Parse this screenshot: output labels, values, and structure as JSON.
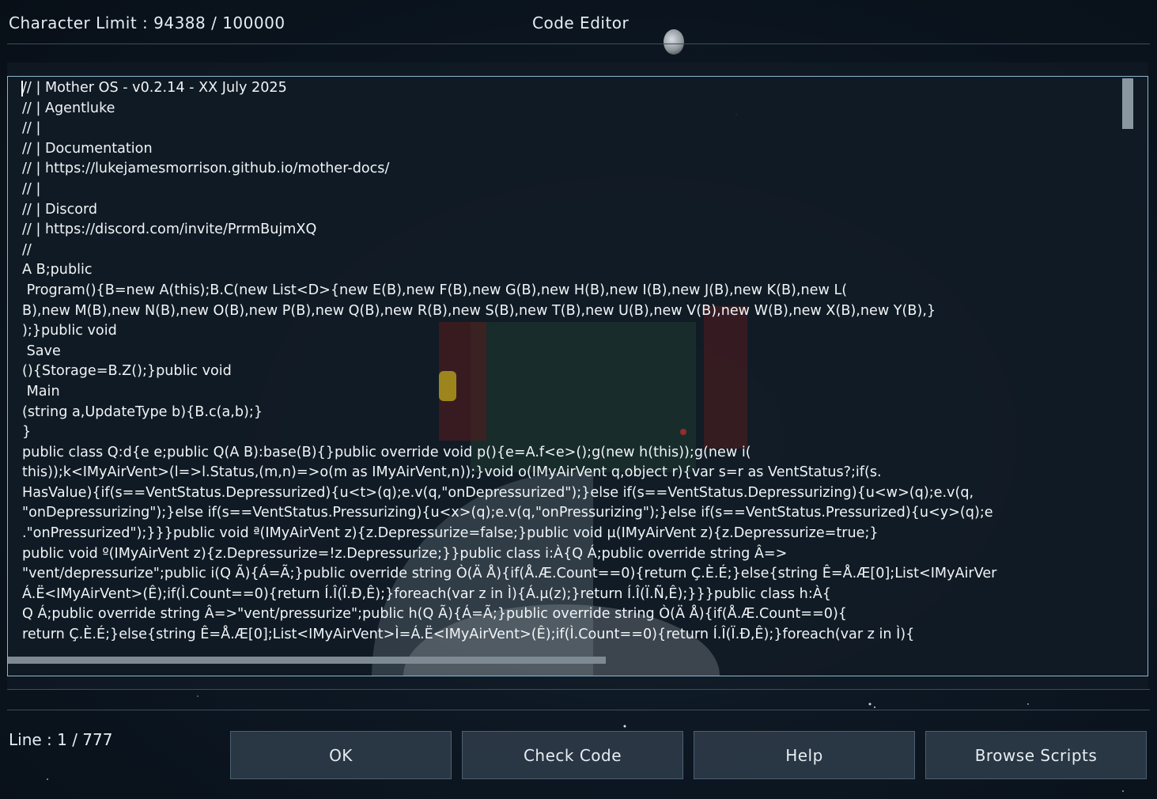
{
  "header": {
    "character_limit": "Character Limit : 94388 / 100000",
    "title": "Code Editor"
  },
  "editor": {
    "lines": [
      "// | Mother OS - v0.2.14 - XX July 2025",
      "// | Agentluke",
      "// |",
      "// | Documentation",
      "// | https://lukejamesmorrison.github.io/mother-docs/",
      "// |",
      "// | Discord",
      "// | https://discord.com/invite/PrrmBujmXQ",
      "//",
      "A B;public",
      " Program(){B=new A(this);B.C(new List<D>{new E(B),new F(B),new G(B),new H(B),new I(B),new J(B),new K(B),new L(",
      "B),new M(B),new N(B),new O(B),new P(B),new Q(B),new R(B),new S(B),new T(B),new U(B),new V(B),new W(B),new X(B),new Y(B),}",
      ");}public void",
      " Save",
      "(){Storage=B.Z();}public void",
      " Main",
      "(string a,UpdateType b){B.c(a,b);}",
      "}",
      "public class Q:d{e e;public Q(A B):base(B){}public override void p(){e=A.f<e>();g(new h(this));g(new i(",
      "this));k<IMyAirVent>(l=>l.Status,(m,n)=>o(m as IMyAirVent,n));}void o(IMyAirVent q,object r){var s=r as VentStatus?;if(s.",
      "HasValue){if(s==VentStatus.Depressurized){u<t>(q);e.v(q,\"onDepressurized\");}else if(s==VentStatus.Depressurizing){u<w>(q);e.v(q,",
      "\"onDepressurizing\");}else if(s==VentStatus.Pressurizing){u<x>(q);e.v(q,\"onPressurizing\");}else if(s==VentStatus.Pressurized){u<y>(q);e",
      ".\"onPressurized\");}}}public void ª(IMyAirVent z){z.Depressurize=false;}public void µ(IMyAirVent z){z.Depressurize=true;}",
      "public void º(IMyAirVent z){z.Depressurize=!z.Depressurize;}}public class i:À{Q Á;public override string Â=>",
      "\"vent/depressurize\";public i(Q Ã){Á=Ã;}public override string Ò(Ä Å){if(Å.Æ.Count==0){return Ç.È.É;}else{string Ê=Å.Æ[0];List<IMyAirVer",
      "Á.Ë<IMyAirVent>(Ê);if(Ì.Count==0){return Í.Î(Ï.Ð,Ê);}foreach(var z in Ì){Á.µ(z);}return Í.Î(Ï.Ñ,Ê);}}}public class h:À{",
      "Q Á;public override string Â=>\"vent/pressurize\";public h(Q Ã){Á=Ã;}public override string Ò(Ä Å){if(Å.Æ.Count==0){",
      "return Ç.È.É;}else{string Ê=Å.Æ[0];List<IMyAirVent>Ì=Á.Ë<IMyAirVent>(Ê);if(Ì.Count==0){return Í.Î(Ï.Ð,Ê);}foreach(var z in Ì){"
    ],
    "scrollbar_vertical_position": 0.0,
    "scrollbar_horizontal_position": 0.0
  },
  "footer": {
    "line_info": "Line : 1 / 777",
    "buttons": {
      "ok": "OK",
      "check_code": "Check Code",
      "help": "Help",
      "browse_scripts": "Browse Scripts"
    }
  },
  "colors": {
    "editor_border": "#8fb6cc",
    "button_bg": "#2c3a47",
    "text": "#e6edf3"
  }
}
